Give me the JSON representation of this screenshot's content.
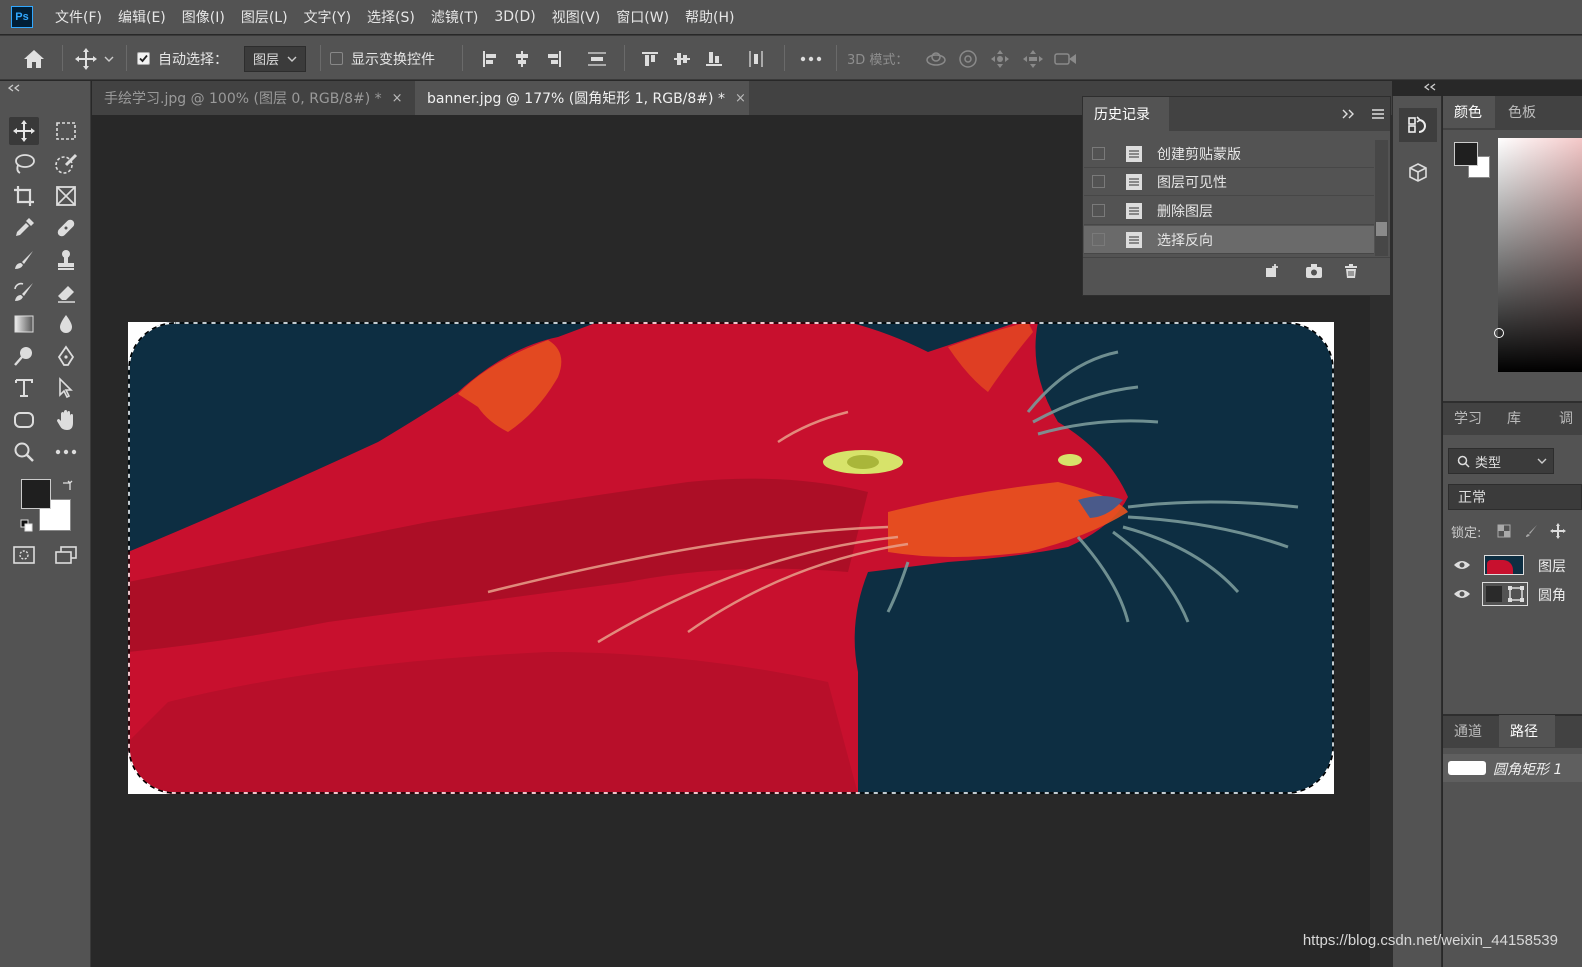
{
  "app": {
    "logo": "Ps"
  },
  "menu": [
    "文件(F)",
    "编辑(E)",
    "图像(I)",
    "图层(L)",
    "文字(Y)",
    "选择(S)",
    "滤镜(T)",
    "3D(D)",
    "视图(V)",
    "窗口(W)",
    "帮助(H)"
  ],
  "options": {
    "auto_select_label": "自动选择：",
    "auto_select_checked": true,
    "auto_select_target": "图层",
    "show_transform_label": "显示变换控件",
    "show_transform_checked": false,
    "mode_3d_label": "3D 模式："
  },
  "tabs": [
    {
      "label": "手绘学习.jpg @ 100% (图层 0, RGB/8#) *",
      "close": "×",
      "active": false
    },
    {
      "label": "banner.jpg @ 177% (圆角矩形 1, RGB/8#) *",
      "close": "×",
      "active": true
    }
  ],
  "history": {
    "title": "历史记录",
    "items": [
      "创建剪贴蒙版",
      "图层可见性",
      "删除图层",
      "选择反向"
    ],
    "selected_index": 3
  },
  "color_panel": {
    "tabs": [
      "颜色",
      "色板"
    ],
    "active": 0
  },
  "layers_panel": {
    "tabs": [
      "学习",
      "库",
      "调"
    ],
    "filter_label": "类型",
    "blend_mode": "正常",
    "lock_label": "锁定:",
    "layers": [
      {
        "name": "图层",
        "visible": true
      },
      {
        "name": "圆角",
        "visible": true
      }
    ]
  },
  "paths_panel": {
    "tabs": [
      "通道",
      "路径"
    ],
    "active": 1,
    "path_name": "圆角矩形 1"
  },
  "colors": {
    "foreground": "#1f1f1f",
    "background": "#ffffff",
    "accent": "#31a8ff"
  },
  "watermark": "https://blog.csdn.net/weixin_44158539"
}
